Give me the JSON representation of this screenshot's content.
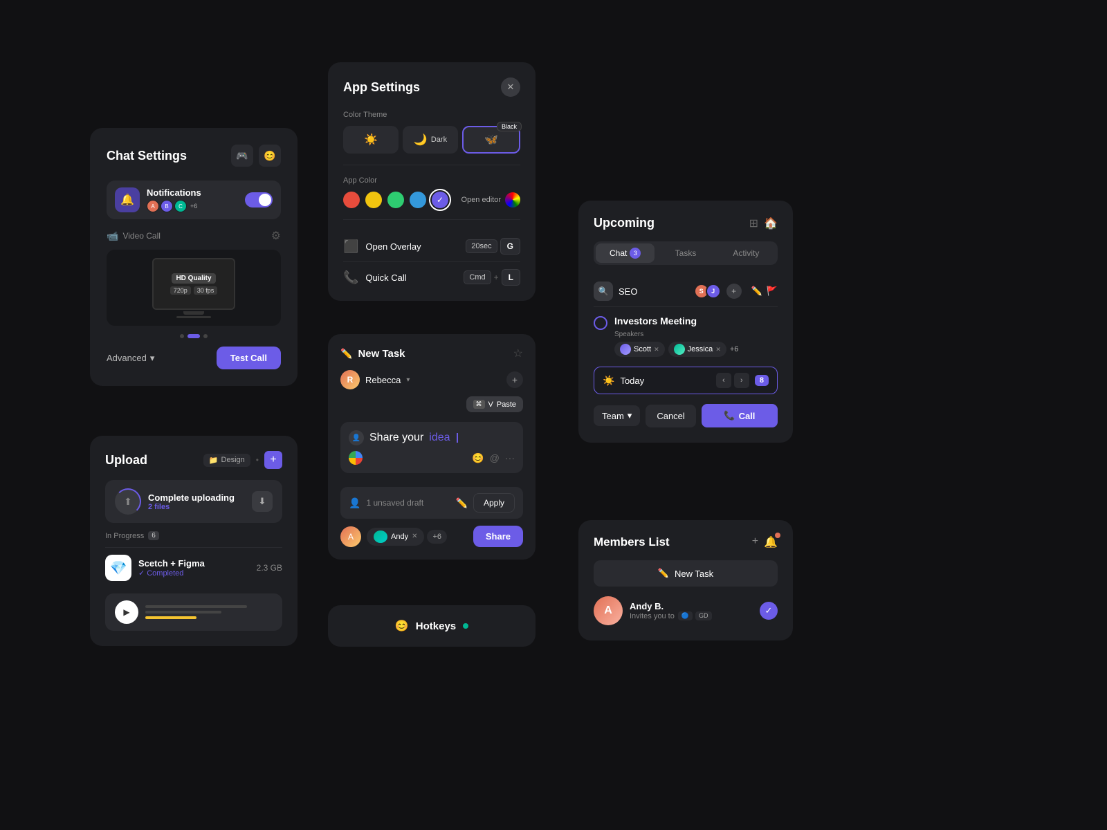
{
  "chatSettings": {
    "title": "Chat Settings",
    "notificationsLabel": "Notifications",
    "videoCallLabel": "Video Call",
    "qualityLabel": "HD Quality",
    "res720": "720p",
    "fps30": "30 fps",
    "advancedLabel": "Advanced",
    "testCallLabel": "Test Call",
    "avatarCount": "+6"
  },
  "upload": {
    "title": "Upload",
    "designLabel": "Design",
    "completeLabel": "Complete uploading",
    "filesLabel": "2 files",
    "inProgressLabel": "In Progress",
    "inProgressCount": "6",
    "fileName": "Scetch + Figma",
    "fileStatus": "Completed",
    "fileSize": "2.3 GB"
  },
  "appSettings": {
    "title": "App Settings",
    "colorThemeLabel": "Color Theme",
    "blackBadge": "Black",
    "darkLabel": "Dark",
    "appColorLabel": "App Color",
    "openEditorLabel": "Open editor",
    "overlayLabel": "Open Overlay",
    "overlayTime": "20sec",
    "overlayKey": "G",
    "quickCallLabel": "Quick Call",
    "cmdKey": "Cmd",
    "lKey": "L"
  },
  "newTask": {
    "title": "New Task",
    "assignee": "Rebecca",
    "shareYourIdea": "Share your",
    "idea": "idea",
    "draftLabel": "1 unsaved draft",
    "applyLabel": "Apply",
    "shareLabel": "Share",
    "user1": "Andy",
    "plusMore": "+6"
  },
  "hotkeys": {
    "title": "Hotkeys"
  },
  "upcoming": {
    "title": "Upcoming",
    "tabChat": "Chat",
    "tabChatCount": "3",
    "tabTasks": "Tasks",
    "tabActivity": "Activity",
    "seoLabel": "SEO",
    "meetingTitle": "Investors Meeting",
    "speakersLabel": "Speakers",
    "speaker1": "Scott",
    "speaker2": "Jessica",
    "plusMore": "+6",
    "todayLabel": "Today",
    "dateNum": "8",
    "teamLabel": "Team",
    "cancelLabel": "Cancel",
    "callLabel": "Call"
  },
  "members": {
    "title": "Members List",
    "newTaskLabel": "New Task",
    "memberName": "Andy B.",
    "inviteText": "Invites you to",
    "badge1": "GD"
  }
}
